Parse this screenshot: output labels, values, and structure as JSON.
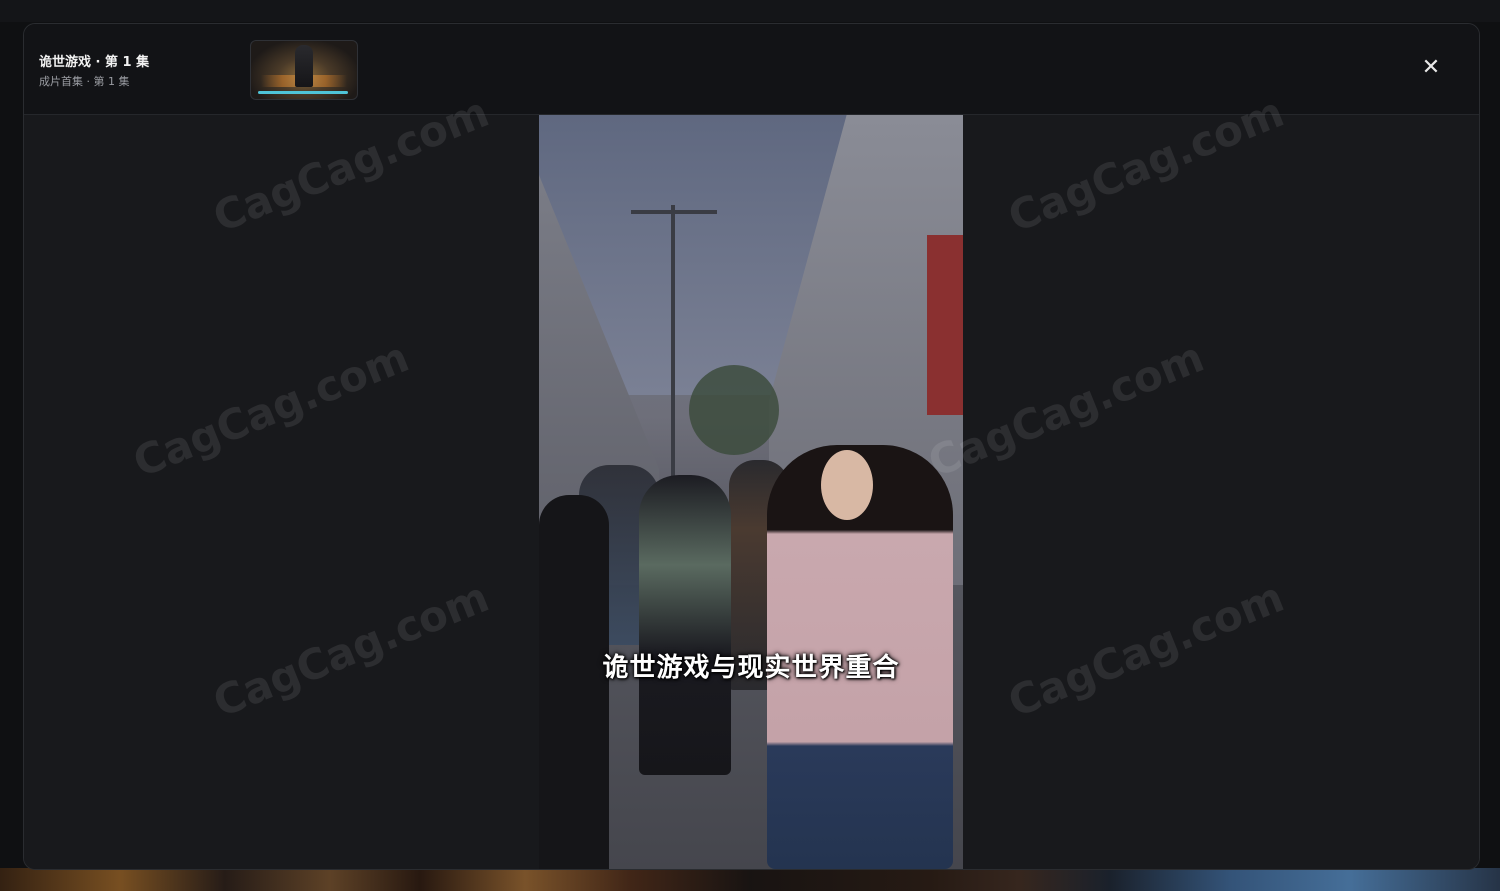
{
  "player": {
    "title": "诡世游戏 · 第 1 集",
    "subtitle": "成片首集 · 第 1 集",
    "thumbnail_progress": 1.0,
    "close_icon_glyph": "✕",
    "video_caption": "诡世游戏与现实世界重合"
  },
  "watermark": {
    "text": "CagCag.com"
  },
  "colors": {
    "accent": "#4fc4d8",
    "modal_bg": "#18191c",
    "header_bg": "#121316"
  }
}
